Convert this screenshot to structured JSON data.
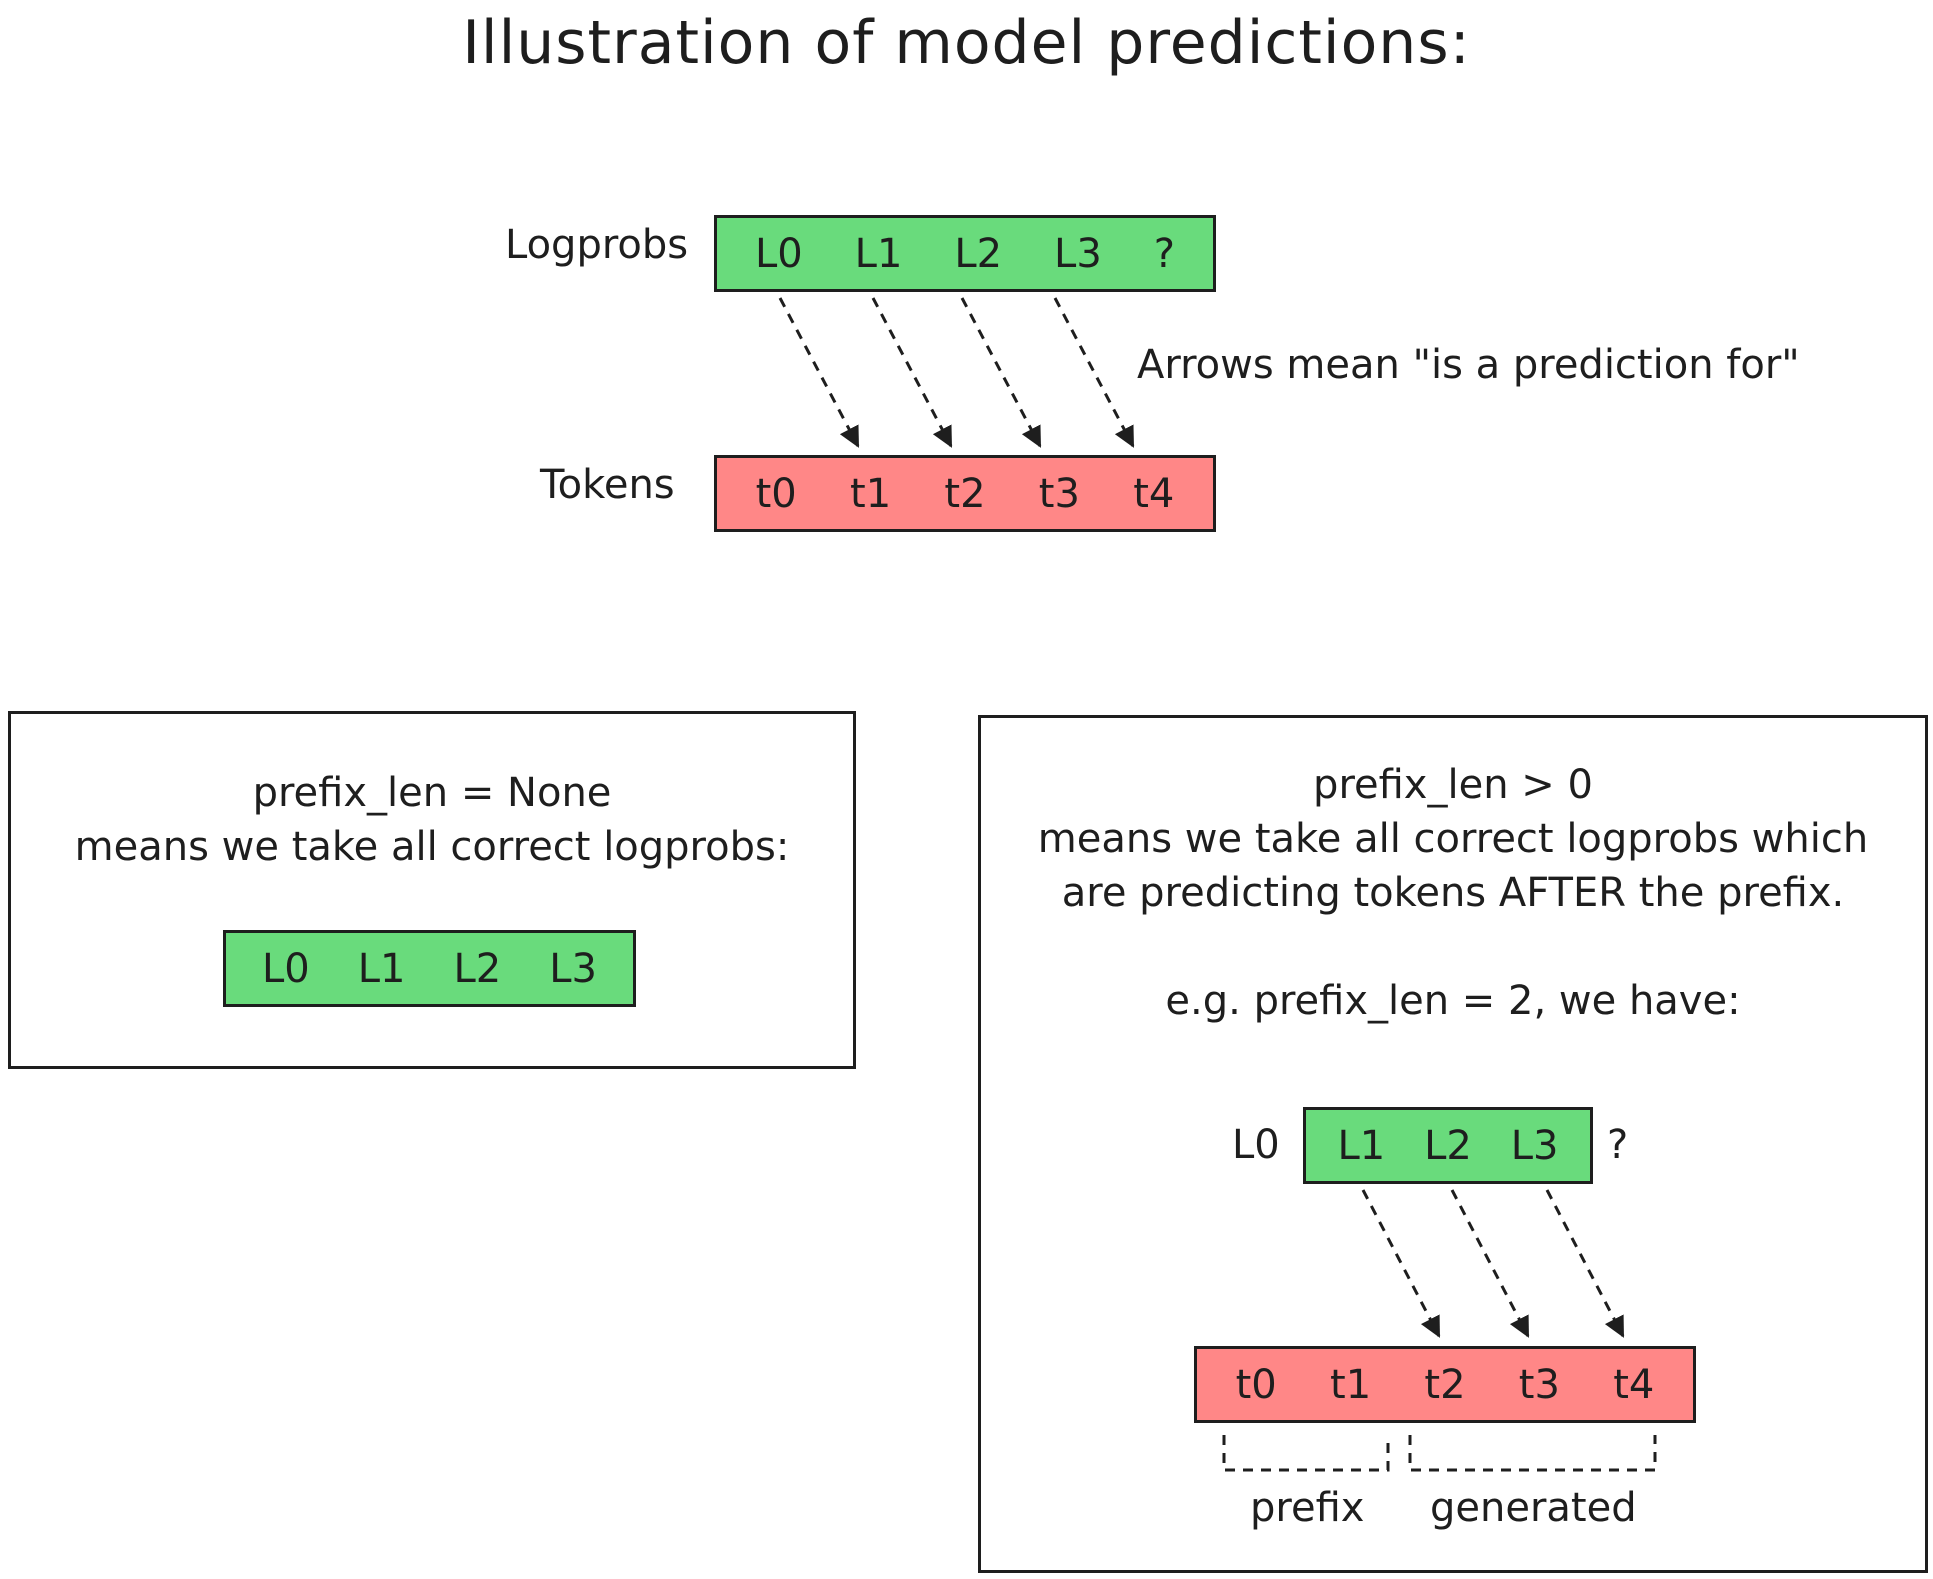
{
  "title": "Illustration of model predictions:",
  "top": {
    "logprobs_label": "Logprobs",
    "tokens_label": "Tokens",
    "logprobs": [
      "L0",
      "L1",
      "L2",
      "L3",
      "?"
    ],
    "tokens": [
      "t0",
      "t1",
      "t2",
      "t3",
      "t4"
    ],
    "arrow_note": "Arrows mean \"is a prediction for\""
  },
  "left_panel": {
    "line1": "prefix_len = None",
    "line2": "means we take all correct logprobs:",
    "logprobs": [
      "L0",
      "L1",
      "L2",
      "L3"
    ]
  },
  "right_panel": {
    "line1": "prefix_len > 0",
    "line2": "means we take all correct logprobs which",
    "line3": "are predicting tokens AFTER the prefix.",
    "example": "e.g. prefix_len = 2, we have:",
    "outside_left": "L0",
    "logprobs": [
      "L1",
      "L2",
      "L3"
    ],
    "outside_right": "?",
    "tokens": [
      "t0",
      "t1",
      "t2",
      "t3",
      "t4"
    ],
    "bracket_prefix": "prefix",
    "bracket_generated": "generated"
  },
  "colors": {
    "green": "#69db7c",
    "red": "#ff8787",
    "stroke": "#1e1e1e"
  }
}
